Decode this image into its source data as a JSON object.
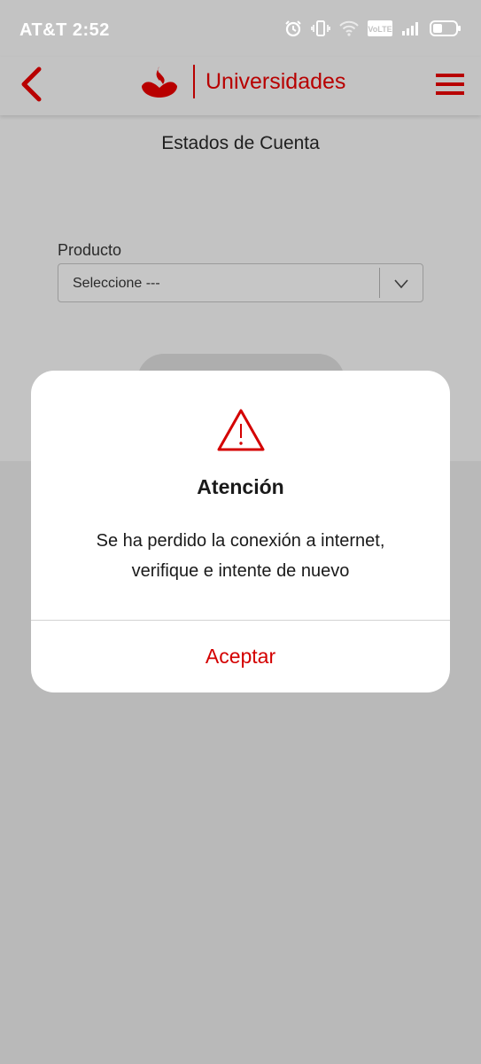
{
  "status_bar": {
    "carrier_time": "AT&T 2:52",
    "icons": [
      "alarm-icon",
      "vibrate-icon",
      "wifi-icon",
      "volte-icon",
      "signal-icon",
      "battery-icon"
    ],
    "volte_label": "VoLTE"
  },
  "header": {
    "back_icon": "chevron-left-icon",
    "brand_name": "Universidades",
    "menu_icon": "hamburger-icon"
  },
  "page": {
    "title": "Estados de Cuenta",
    "product_label": "Producto",
    "product_select_value": "Seleccione ---"
  },
  "dialog": {
    "icon": "warning-icon",
    "title": "Atención",
    "message_line1": "Se ha perdido la conexión a internet,",
    "message_line2": "verifique e intente de nuevo",
    "accept_label": "Aceptar"
  },
  "colors": {
    "brand_red": "#b80000",
    "accept_red": "#d40000",
    "overlay_gray": "#b9b9b9",
    "dialog_bg": "#ffffff"
  }
}
